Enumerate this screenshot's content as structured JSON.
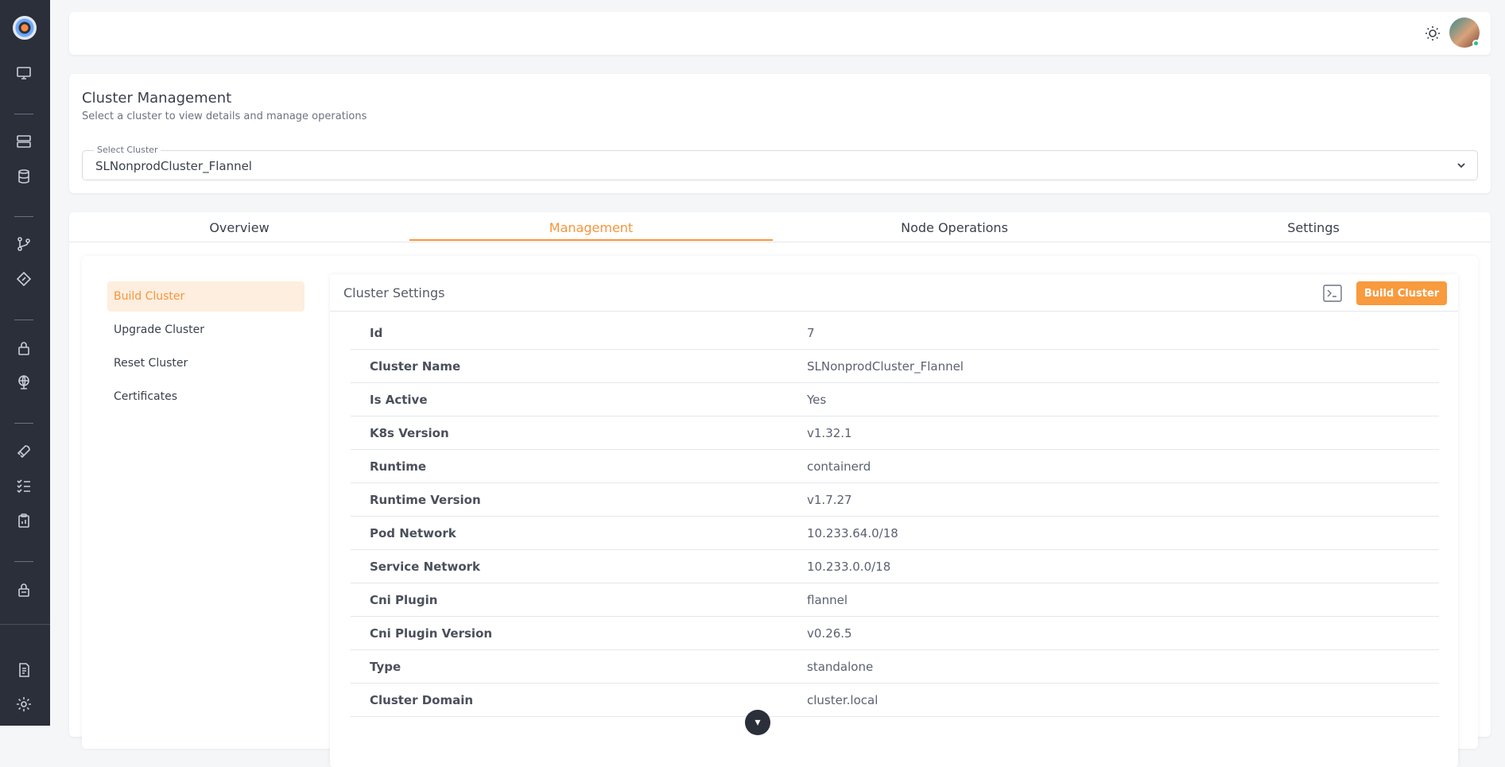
{
  "header": {
    "theme_icon": "sun-icon",
    "avatar_icon": "user-avatar"
  },
  "sidebar": {
    "icons": [
      "monitor-icon",
      "server-icon",
      "database-icon",
      "git-branch-icon",
      "diamond-tag-icon",
      "lock-icon",
      "network-globe-icon",
      "rocket-icon",
      "checklist-icon",
      "clipboard-icon",
      "lock-icon",
      "document-icon",
      "gear-icon"
    ]
  },
  "cluster": {
    "title": "Cluster Management",
    "subtitle": "Select a cluster to view details and manage operations",
    "select_label": "Select Cluster",
    "selected_value": "SLNonprodCluster_Flannel"
  },
  "tabs": [
    {
      "label": "Overview"
    },
    {
      "label": "Management"
    },
    {
      "label": "Node Operations"
    },
    {
      "label": "Settings"
    }
  ],
  "management_menu": [
    {
      "label": "Build Cluster"
    },
    {
      "label": "Upgrade Cluster"
    },
    {
      "label": "Reset Cluster"
    },
    {
      "label": "Certificates"
    }
  ],
  "settings": {
    "title": "Cluster Settings",
    "build_button": "Build Cluster",
    "rows": [
      {
        "key": "Id",
        "value": "7"
      },
      {
        "key": "Cluster Name",
        "value": "SLNonprodCluster_Flannel"
      },
      {
        "key": "Is Active",
        "value": "Yes"
      },
      {
        "key": "K8s Version",
        "value": "v1.32.1"
      },
      {
        "key": "Runtime",
        "value": "containerd"
      },
      {
        "key": "Runtime Version",
        "value": "v1.7.27"
      },
      {
        "key": "Pod Network",
        "value": "10.233.64.0/18"
      },
      {
        "key": "Service Network",
        "value": "10.233.0.0/18"
      },
      {
        "key": "Cni Plugin",
        "value": "flannel"
      },
      {
        "key": "Cni Plugin Version",
        "value": "v0.26.5"
      },
      {
        "key": "Type",
        "value": "standalone"
      },
      {
        "key": "Cluster Domain",
        "value": "cluster.local"
      }
    ]
  },
  "colors": {
    "accent": "#f7953a",
    "sidebar_bg": "#2a2f3a",
    "active_menu_bg": "#fdeedf"
  }
}
